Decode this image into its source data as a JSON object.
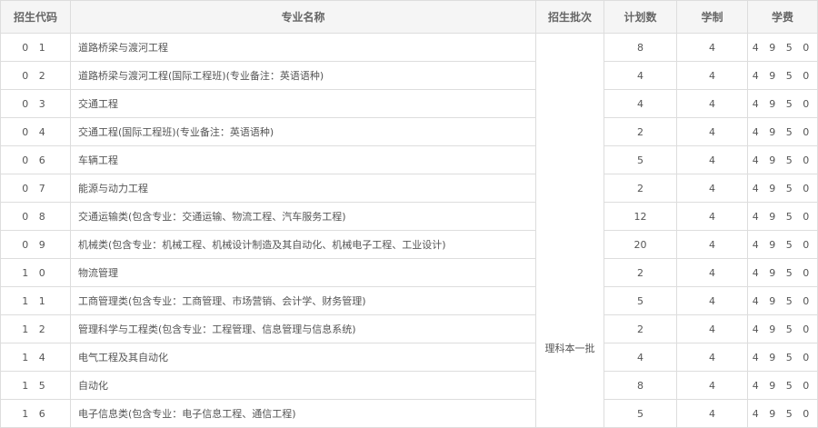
{
  "table": {
    "headers": [
      "招生代码",
      "专业名称",
      "招生批次",
      "计划数",
      "学制",
      "学费"
    ],
    "batch": "理科本一批",
    "rows": [
      {
        "code": "0 1",
        "name": "道路桥梁与渡河工程",
        "plan": "8",
        "years": "4",
        "fee": "4 9 5 0"
      },
      {
        "code": "0 2",
        "name": "道路桥梁与渡河工程(国际工程班)(专业备注：英语语种)",
        "plan": "4",
        "years": "4",
        "fee": "4 9 5 0"
      },
      {
        "code": "0 3",
        "name": "交通工程",
        "plan": "4",
        "years": "4",
        "fee": "4 9 5 0"
      },
      {
        "code": "0 4",
        "name": "交通工程(国际工程班)(专业备注：英语语种)",
        "plan": "2",
        "years": "4",
        "fee": "4 9 5 0"
      },
      {
        "code": "0 6",
        "name": "车辆工程",
        "plan": "5",
        "years": "4",
        "fee": "4 9 5 0"
      },
      {
        "code": "0 7",
        "name": "能源与动力工程",
        "plan": "2",
        "years": "4",
        "fee": "4 9 5 0"
      },
      {
        "code": "0 8",
        "name": "交通运输类(包含专业：交通运输、物流工程、汽车服务工程)",
        "plan": "12",
        "years": "4",
        "fee": "4 9 5 0"
      },
      {
        "code": "0 9",
        "name": "机械类(包含专业：机械工程、机械设计制造及其自动化、机械电子工程、工业设计)",
        "plan": "20",
        "years": "4",
        "fee": "4 9 5 0"
      },
      {
        "code": "1 0",
        "name": "物流管理",
        "plan": "2",
        "years": "4",
        "fee": "4 9 5 0"
      },
      {
        "code": "1 1",
        "name": "工商管理类(包含专业：工商管理、市场营销、会计学、财务管理)",
        "plan": "5",
        "years": "4",
        "fee": "4 9 5 0"
      },
      {
        "code": "1 2",
        "name": "管理科学与工程类(包含专业：工程管理、信息管理与信息系统)",
        "plan": "2",
        "years": "4",
        "fee": "4 9 5 0"
      },
      {
        "code": "1 4",
        "name": "电气工程及其自动化",
        "plan": "4",
        "years": "4",
        "fee": "4 9 5 0"
      },
      {
        "code": "1 5",
        "name": "自动化",
        "plan": "8",
        "years": "4",
        "fee": "4 9 5 0"
      },
      {
        "code": "1 6",
        "name": "电子信息类(包含专业：电子信息工程、通信工程)",
        "plan": "5",
        "years": "4",
        "fee": "4 9 5 0"
      }
    ]
  }
}
